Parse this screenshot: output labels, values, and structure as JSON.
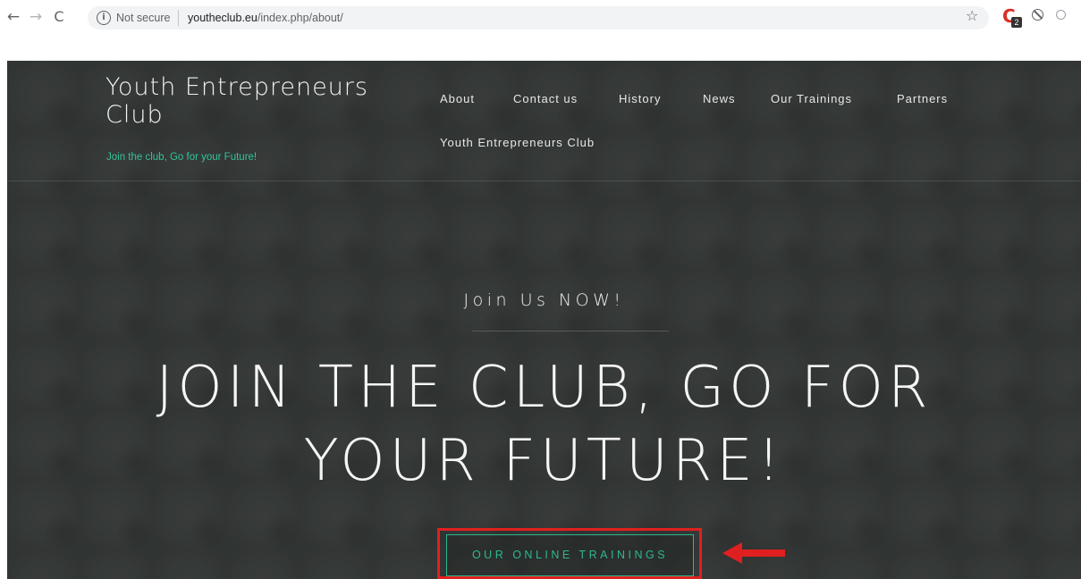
{
  "browser": {
    "nav": {
      "back_icon": "←",
      "forward_icon": "→",
      "reload_icon": "C"
    },
    "address_bar": {
      "info_icon": "i",
      "security_label": "Not secure",
      "host": "youtheclub.eu",
      "path": "/index.php/about/"
    },
    "extensions": {
      "badge_count": "2",
      "ext_letter": "C"
    },
    "star_icon": "☆"
  },
  "site": {
    "brand_title": "Youth Entrepreneurs Club",
    "tagline": "Join the club, Go for your Future!",
    "nav": [
      {
        "label": "About"
      },
      {
        "label": "Contact us"
      },
      {
        "label": "History"
      },
      {
        "label": "News"
      },
      {
        "label": "Our Trainings"
      },
      {
        "label": "Partners"
      },
      {
        "label": "Youth Entrepreneurs Club"
      }
    ]
  },
  "hero": {
    "kicker": "Join Us NOW!",
    "headline_line1": "JOIN THE CLUB, GO FOR",
    "headline_line2": "YOUR FUTURE!",
    "cta_label": "OUR ONLINE TRAININGS"
  },
  "colors": {
    "accent": "#2fb88f",
    "tagline": "#33c49a",
    "highlight_box": "#e02020",
    "hero_bg": "#3a3d3c"
  }
}
